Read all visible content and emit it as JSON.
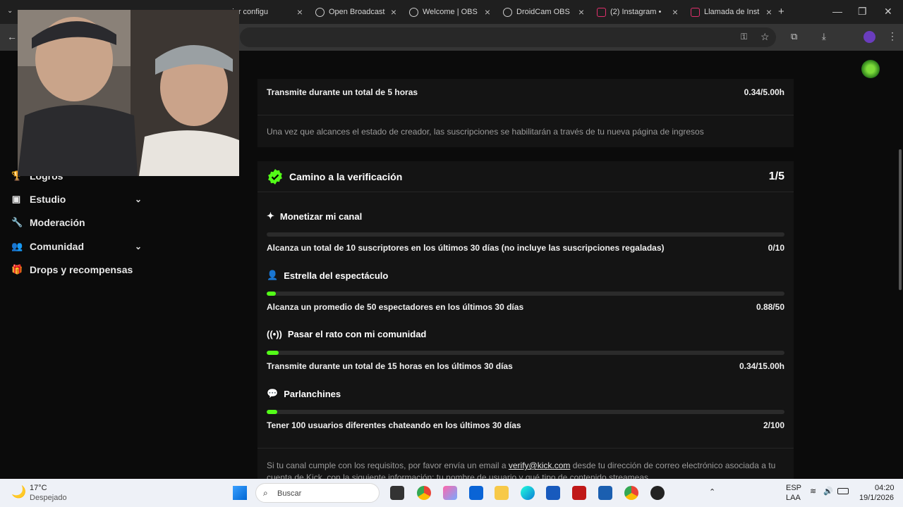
{
  "browser": {
    "tabs": [
      {
        "title": "mejor configu"
      },
      {
        "title": "Open Broadcast"
      },
      {
        "title": "Welcome | OBS"
      },
      {
        "title": "DroidCam OBS"
      },
      {
        "title": "(2) Instagram •"
      },
      {
        "title": "Llamada de Inst"
      }
    ],
    "new_tab": "+"
  },
  "sidebar": {
    "items": [
      {
        "label": "Logros"
      },
      {
        "label": "Estudio"
      },
      {
        "label": "Moderación"
      },
      {
        "label": "Comunidad"
      },
      {
        "label": "Drops y recompensas"
      }
    ]
  },
  "creator_card": {
    "row_text": "Transmite durante un total de 5 horas",
    "row_value": "0.34/5.00h",
    "note": "Una vez que alcances el estado de creador, las suscripciones se habilitarán a través de tu nueva página de ingresos"
  },
  "verification": {
    "title": "Camino a la verificación",
    "progress": "1/5",
    "sections": [
      {
        "title": "Monetizar mi canal",
        "desc": "Alcanza un total de 10 suscriptores en los últimos 30 días (no incluye las suscripciones regaladas)",
        "value": "0/10",
        "fill": 0
      },
      {
        "title": "Estrella del espectáculo",
        "desc": "Alcanza un promedio de 50 espectadores en los últimos 30 días",
        "value": "0.88/50",
        "fill": 0.018
      },
      {
        "title": "Pasar el rato con mi comunidad",
        "desc": "Transmite durante un total de 15 horas en los últimos 30 días",
        "value": "0.34/15.00h",
        "fill": 0.023
      },
      {
        "title": "Parlanchines",
        "desc": "Tener 100 usuarios diferentes chateando en los últimos 30 días",
        "value": "2/100",
        "fill": 0.02
      }
    ],
    "footer_pre": "Si tu canal cumple con los requisitos, por favor envía un email a",
    "footer_email": "verify@kick.com",
    "footer_post": "desde tu dirección de correo electrónico asociada",
    "footer_line2": "a tu cuenta de Kick, con la siguiente información: tu nombre de usuario y qué tipo de contenido streameas."
  },
  "taskbar": {
    "weather_temp": "17°C",
    "weather_desc": "Despejado",
    "search_placeholder": "Buscar",
    "lang": "ESP",
    "lang2": "LAA",
    "time": "04:20",
    "date": "19/1/2026"
  },
  "colors": {
    "accent": "#53fc18"
  }
}
